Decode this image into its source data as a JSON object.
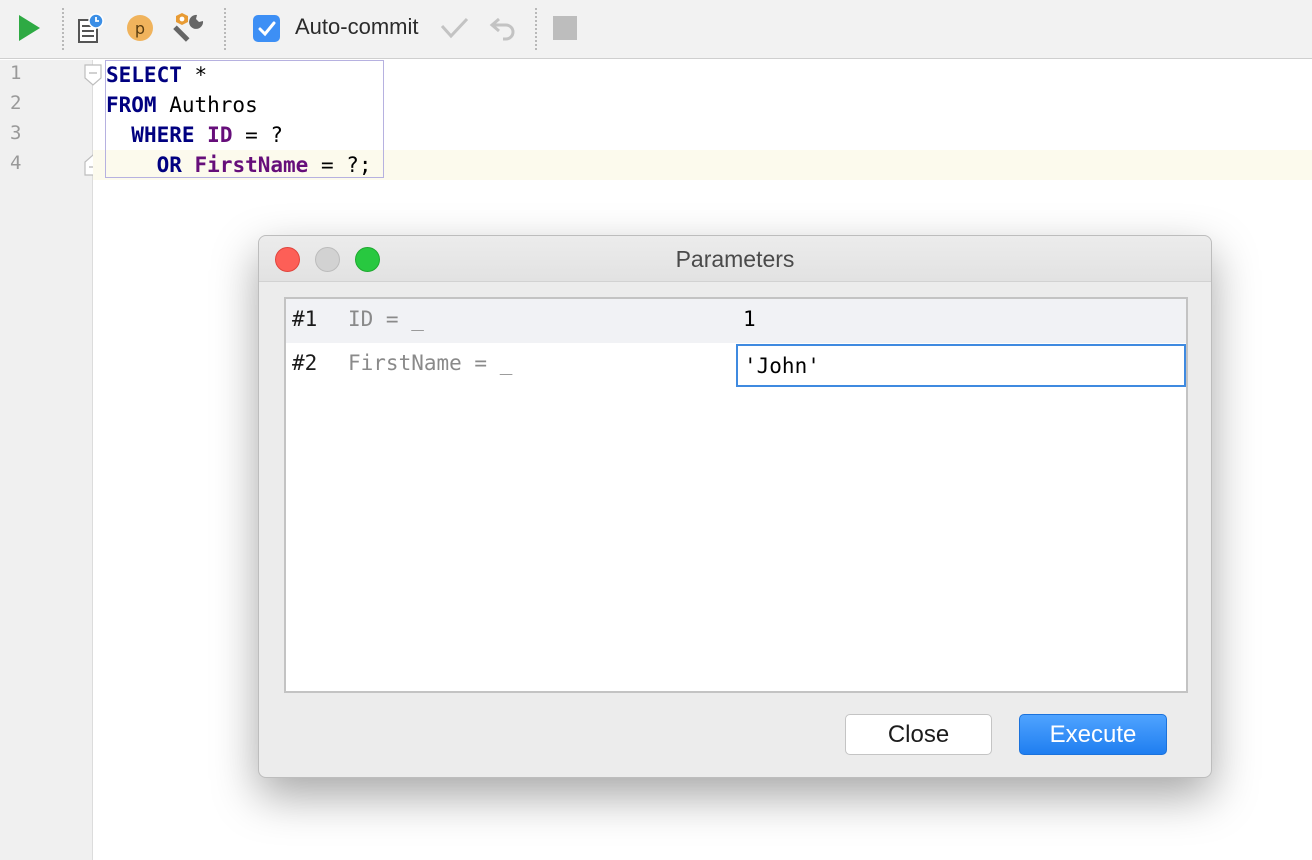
{
  "toolbar": {
    "auto_commit_label": "Auto-commit",
    "auto_commit_checked": true,
    "icons": [
      "run-icon",
      "explain-plan-icon",
      "parameter-p-icon",
      "settings-wrench-icon",
      "commit-check-icon",
      "rollback-icon",
      "stop-icon"
    ]
  },
  "editor": {
    "line_numbers": [
      "1",
      "2",
      "3",
      "4"
    ],
    "lines": [
      {
        "kw": "SELECT",
        "rest": " *"
      },
      {
        "kw": "FROM",
        "rest": " Authros"
      },
      {
        "lead": "  ",
        "kw": "WHERE",
        "col": "ID",
        "rest": " = ?"
      },
      {
        "lead": "    ",
        "kw": "OR",
        "col": "FirstName",
        "rest": " = ?;"
      }
    ]
  },
  "dialog": {
    "title": "Parameters",
    "rows": [
      {
        "num": "#1",
        "name": "ID = _",
        "value": "1"
      },
      {
        "num": "#2",
        "name": "FirstName = _",
        "value": "'John'"
      }
    ],
    "close_label": "Close",
    "execute_label": "Execute"
  },
  "colors": {
    "accent": "#3d8ff5",
    "keyword": "#000080",
    "column": "#660e7a",
    "run_green": "#2eaa43",
    "light_red": "#fd5f57",
    "light_gray": "#d2d2d2",
    "light_green": "#28c840"
  }
}
